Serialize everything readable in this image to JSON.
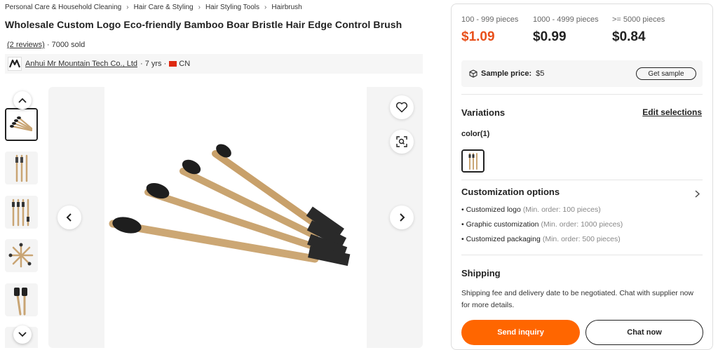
{
  "breadcrumb": [
    "Personal Care & Household Cleaning",
    "Hair Care & Styling",
    "Hair Styling Tools",
    "Hairbrush"
  ],
  "product": {
    "title": "Wholesale Custom Logo Eco-friendly Bamboo Boar Bristle Hair Edge Control Brush",
    "reviews": "(2 reviews)",
    "sold": "· 7000 sold"
  },
  "supplier": {
    "name": "Anhui Mr Mountain Tech Co., Ltd",
    "years": "· 7 yrs ·",
    "country": "CN"
  },
  "pricing": [
    {
      "tier": "100 - 999 pieces",
      "price": "$1.09"
    },
    {
      "tier": "1000 - 4999 pieces",
      "price": "$0.99"
    },
    {
      "tier": ">= 5000 pieces",
      "price": "$0.84"
    }
  ],
  "sample": {
    "label": "Sample price:",
    "value": "$5",
    "button": "Get sample"
  },
  "variations": {
    "title": "Variations",
    "edit": "Edit selections",
    "color_label": "color(1)"
  },
  "customization": {
    "title": "Customization options",
    "options": [
      {
        "name": "Customized logo",
        "note": "(Min. order: 100 pieces)"
      },
      {
        "name": "Graphic customization",
        "note": "(Min. order: 1000 pieces)"
      },
      {
        "name": "Customized packaging",
        "note": "(Min. order: 500 pieces)"
      }
    ]
  },
  "shipping": {
    "title": "Shipping",
    "text": "Shipping fee and delivery date to be negotiated. Chat with supplier now for more details."
  },
  "actions": {
    "inquiry": "Send inquiry",
    "chat": "Chat now"
  },
  "colors": {
    "accent": "#ff6600",
    "price_accent": "#e8501b",
    "flag": "#de2910"
  },
  "icons": [
    "chevron-up-icon",
    "chevron-down-icon",
    "chevron-left-icon",
    "chevron-right-icon",
    "heart-icon",
    "image-search-icon",
    "package-icon",
    "supplier-logo-icon"
  ]
}
